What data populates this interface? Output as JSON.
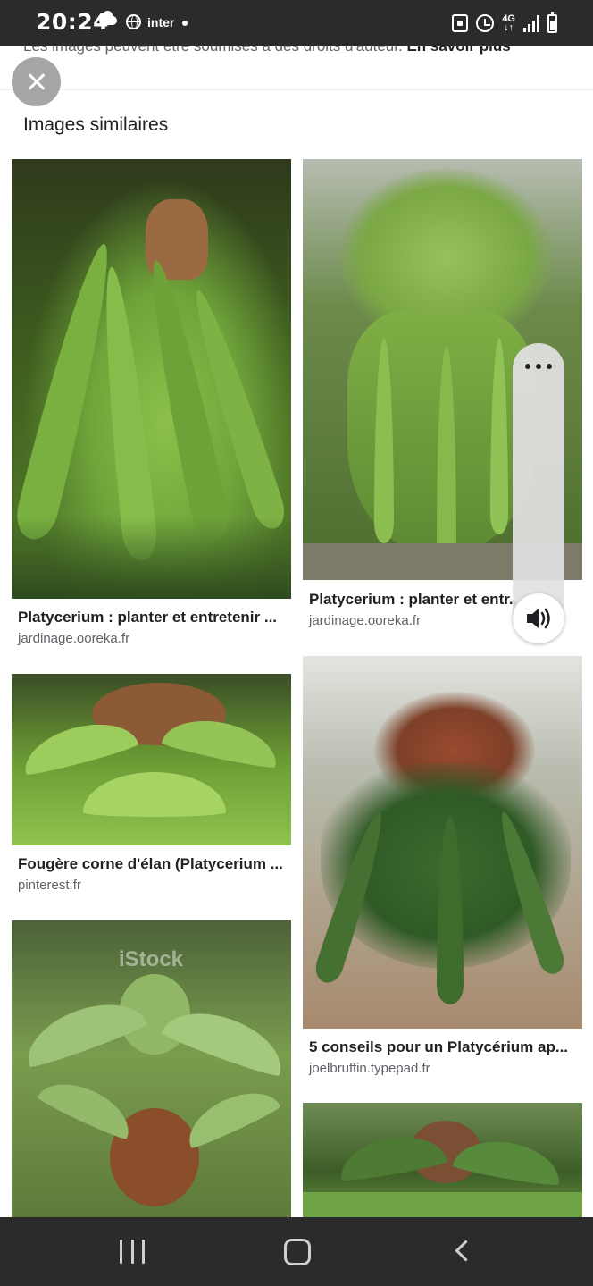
{
  "status_bar": {
    "time": "20:24",
    "carrier": "inter",
    "network": "4G",
    "icons": [
      "cloud-icon",
      "globe-icon",
      "dot-icon",
      "screenshot-icon",
      "alarm-icon",
      "signal-icon",
      "battery-icon"
    ]
  },
  "notice": {
    "text": "Les images peuvent être soumises à des droits d'auteur.",
    "link": "En savoir plus"
  },
  "header": {
    "section_title": "Images similaires"
  },
  "results": [
    {
      "title": "Platycerium : planter et entretenir ...",
      "source": "jardinage.ooreka.fr"
    },
    {
      "title": "Platycerium : planter et entr...",
      "source": "jardinage.ooreka.fr"
    },
    {
      "title": "Fougère corne d'élan (Platycerium ...",
      "source": "pinterest.fr"
    },
    {
      "title": "5 conseils pour un Platycérium ap...",
      "source": "joelbruffin.typepad.fr"
    },
    {
      "title": "",
      "source": ""
    },
    {
      "title": "",
      "source": ""
    }
  ],
  "watermark": "iStock",
  "side_controls": {
    "icons": [
      "more-icon",
      "volume-icon"
    ]
  },
  "nav_bar": {
    "icons": [
      "recents-icon",
      "home-icon",
      "back-icon"
    ]
  },
  "colors": {
    "system_bar": "#2b2b2b",
    "title_text": "#202124",
    "secondary_text": "#5f6368",
    "foliage": "#6fa43a"
  }
}
